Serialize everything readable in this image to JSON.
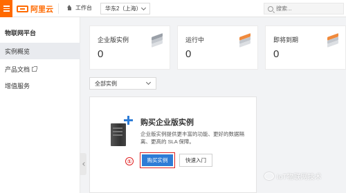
{
  "header": {
    "brand_name": "阿里云",
    "workbench_label": "工作台",
    "region_selected": "华东2（上海）",
    "search_placeholder": "搜索..."
  },
  "sidebar": {
    "title": "物联网平台",
    "items": [
      {
        "label": "实例概览",
        "active": true
      },
      {
        "label": "产品文档",
        "external": true
      },
      {
        "label": "增值服务"
      }
    ]
  },
  "stats": [
    {
      "label": "企业版实例",
      "value": "0",
      "icon": "stack-gray-icon"
    },
    {
      "label": "运行中",
      "value": "0",
      "icon": "stack-orange-icon"
    },
    {
      "label": "即将到期",
      "value": "0",
      "icon": "stack-orange-icon"
    }
  ],
  "filter": {
    "selected": "全部实例"
  },
  "empty_state": {
    "title": "购买企业版实例",
    "description": "企业版实例提供更丰富的功能、更好的数据隔离、更高的 SLA 保障。",
    "step_marker": "①",
    "primary_button": "购买实例",
    "secondary_button": "快速入门"
  },
  "watermark": {
    "text": "IoT物联网技术"
  },
  "colors": {
    "brand_orange": "#ff6a00",
    "primary_blue": "#2e7cd6",
    "highlight_red": "#e02020"
  }
}
